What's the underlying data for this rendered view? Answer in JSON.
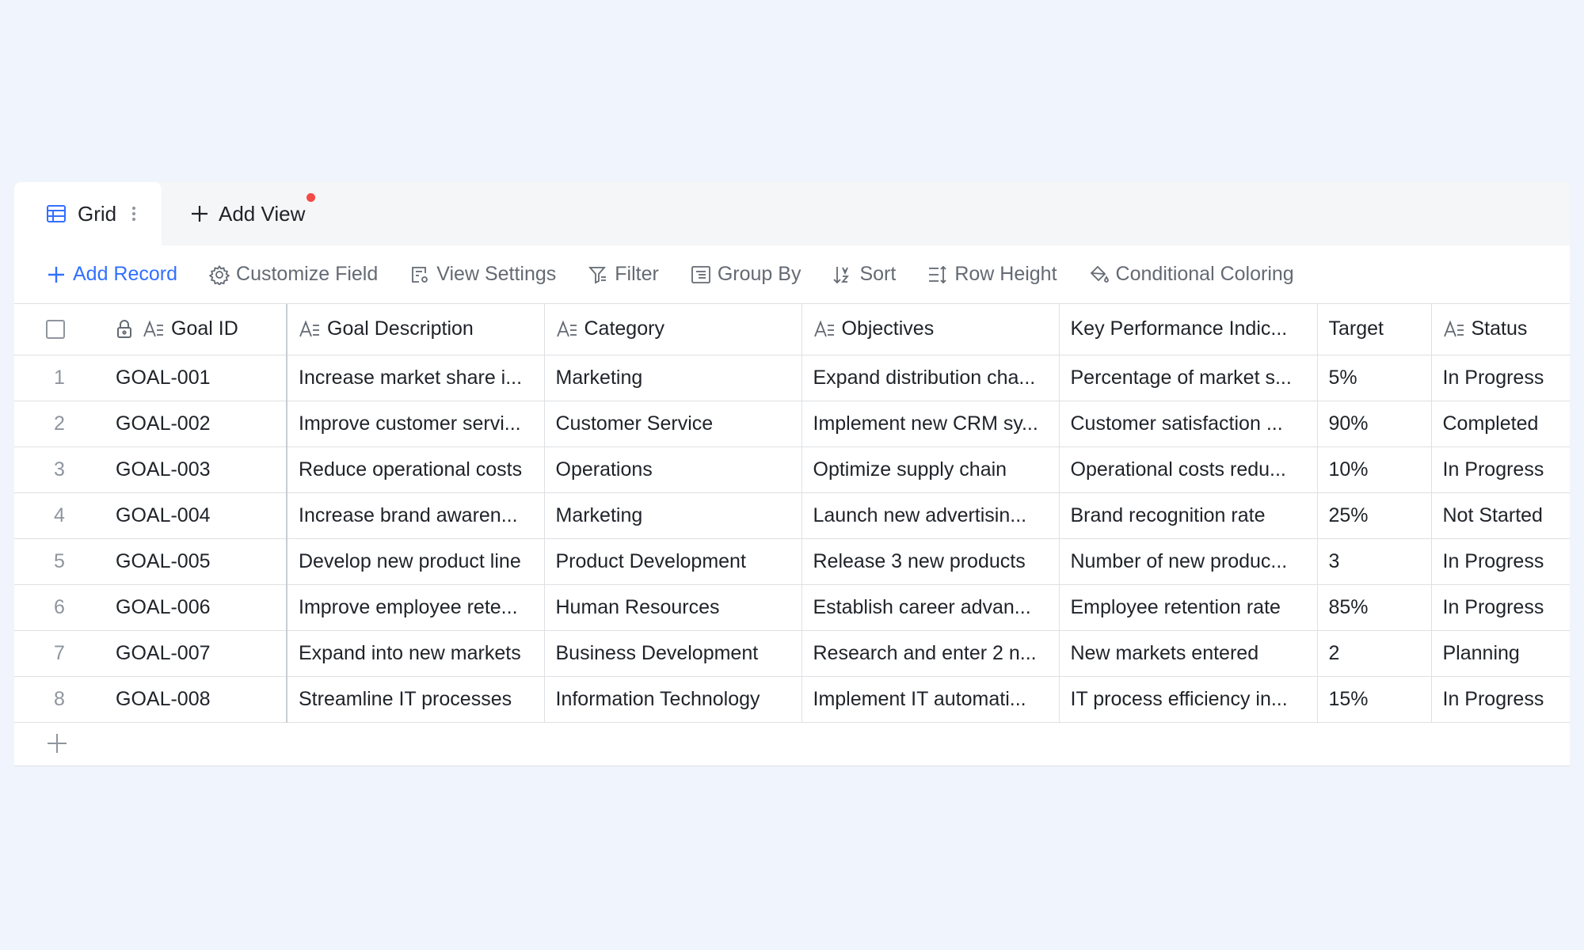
{
  "tabs": {
    "active_label": "Grid",
    "add_view_label": "Add View"
  },
  "toolbar": {
    "add_record": "Add Record",
    "customize_field": "Customize Field",
    "view_settings": "View Settings",
    "filter": "Filter",
    "group_by": "Group By",
    "sort": "Sort",
    "row_height": "Row Height",
    "conditional_coloring": "Conditional Coloring"
  },
  "columns": {
    "goal_id": "Goal ID",
    "goal_description": "Goal Description",
    "category": "Category",
    "objectives": "Objectives",
    "kpi": "Key Performance Indic...",
    "target": "Target",
    "status": "Status"
  },
  "rows": [
    {
      "num": "1",
      "id": "GOAL-001",
      "desc": "Increase market share i...",
      "category": "Marketing",
      "objectives": "Expand distribution cha...",
      "kpi": "Percentage of market s...",
      "target": "5%",
      "status": "In Progress"
    },
    {
      "num": "2",
      "id": "GOAL-002",
      "desc": "Improve customer servi...",
      "category": "Customer Service",
      "objectives": "Implement new CRM sy...",
      "kpi": "Customer satisfaction ...",
      "target": "90%",
      "status": "Completed"
    },
    {
      "num": "3",
      "id": "GOAL-003",
      "desc": "Reduce operational costs",
      "category": "Operations",
      "objectives": "Optimize supply chain",
      "kpi": "Operational costs redu...",
      "target": "10%",
      "status": "In Progress"
    },
    {
      "num": "4",
      "id": "GOAL-004",
      "desc": "Increase brand awaren...",
      "category": "Marketing",
      "objectives": "Launch new advertisin...",
      "kpi": "Brand recognition rate",
      "target": "25%",
      "status": "Not Started"
    },
    {
      "num": "5",
      "id": "GOAL-005",
      "desc": "Develop new product line",
      "category": "Product Development",
      "objectives": "Release 3 new products",
      "kpi": "Number of new produc...",
      "target": "3",
      "status": "In Progress"
    },
    {
      "num": "6",
      "id": "GOAL-006",
      "desc": "Improve employee rete...",
      "category": "Human Resources",
      "objectives": "Establish career advan...",
      "kpi": "Employee retention rate",
      "target": "85%",
      "status": "In Progress"
    },
    {
      "num": "7",
      "id": "GOAL-007",
      "desc": "Expand into new markets",
      "category": "Business Development",
      "objectives": "Research and enter 2 n...",
      "kpi": "New markets entered",
      "target": "2",
      "status": "Planning"
    },
    {
      "num": "8",
      "id": "GOAL-008",
      "desc": "Streamline IT processes",
      "category": "Information Technology",
      "objectives": "Implement IT automati...",
      "kpi": "IT process efficiency in...",
      "target": "15%",
      "status": "In Progress"
    }
  ],
  "colors": {
    "accent": "#3370ff",
    "notification_dot": "#f54a45",
    "background": "#f0f4fd"
  }
}
